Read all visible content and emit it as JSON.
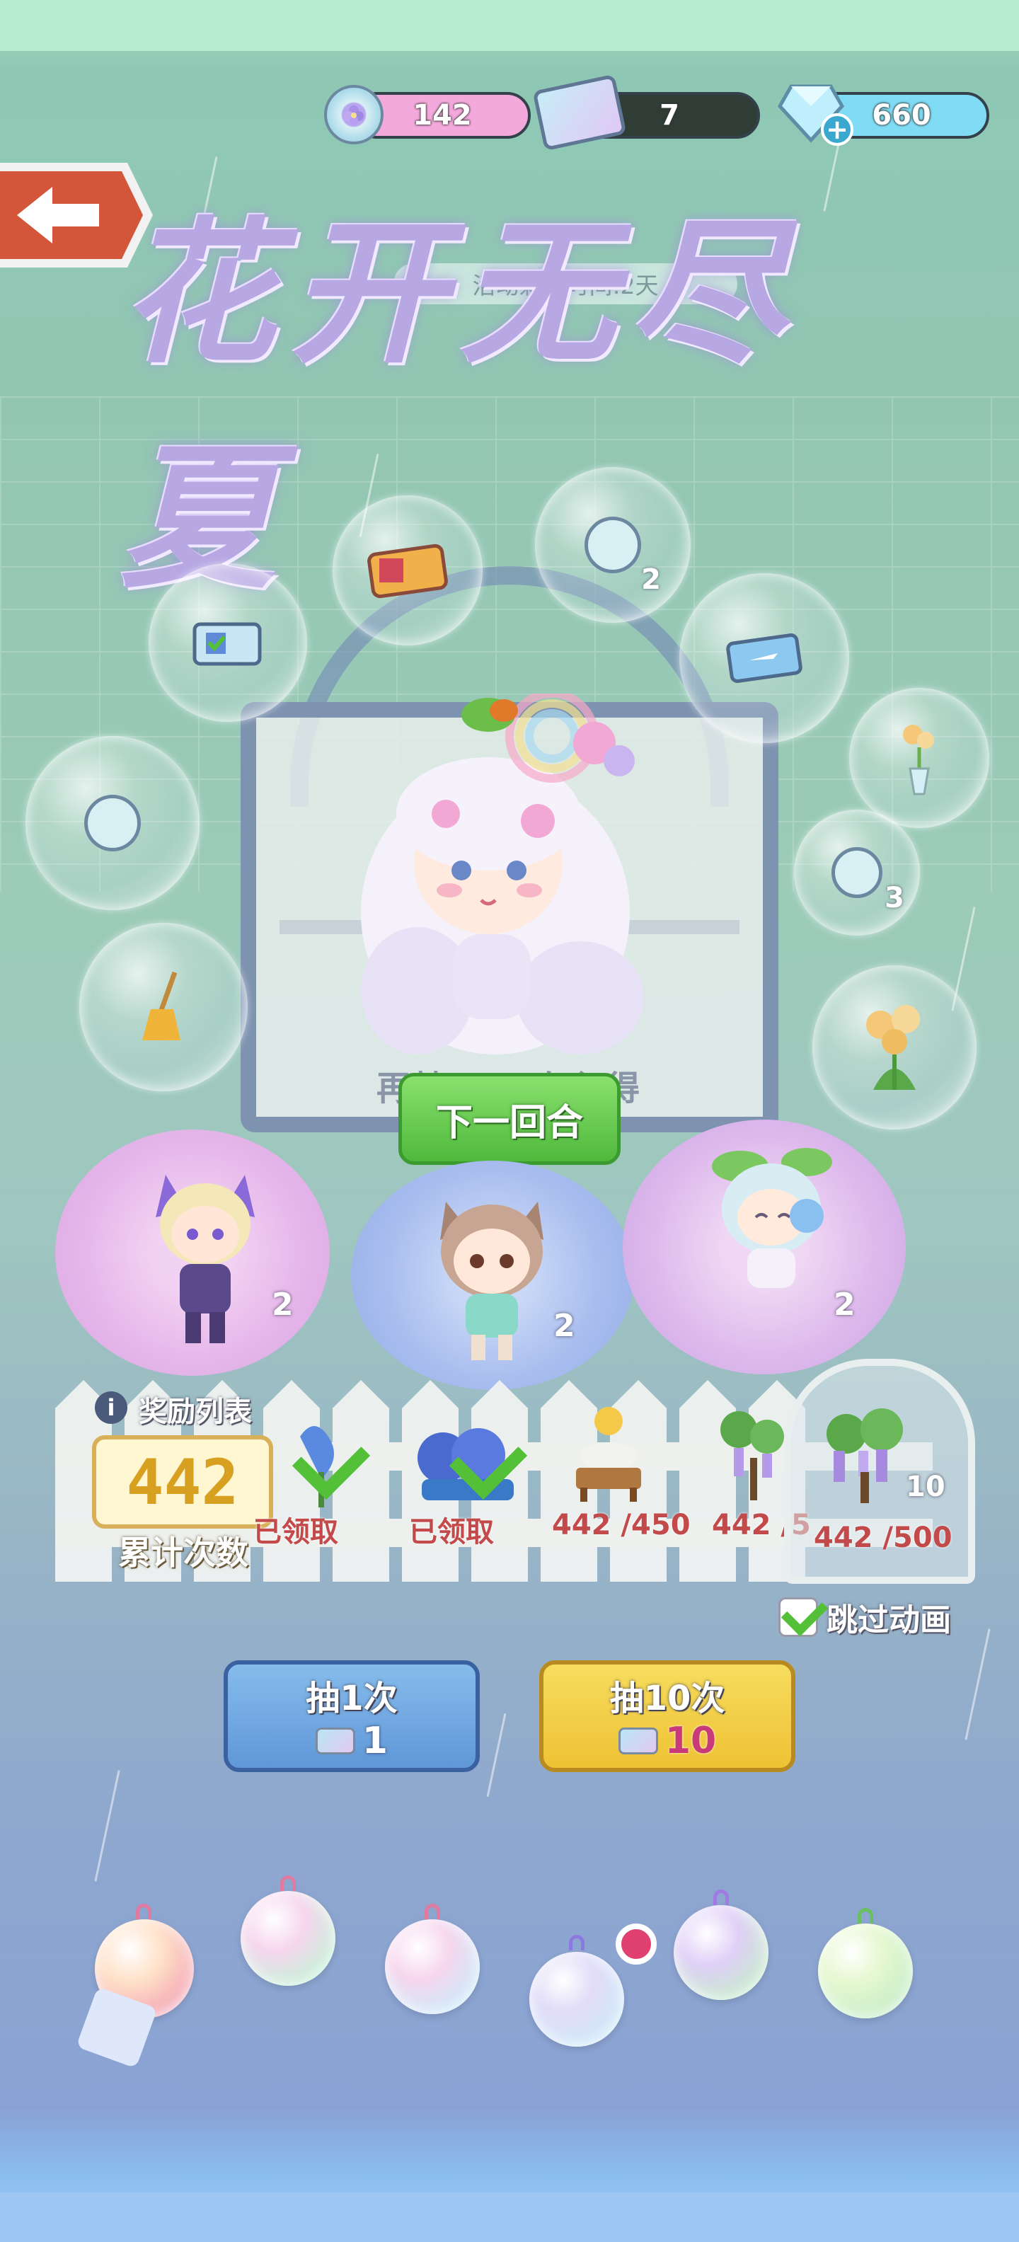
{
  "currency": {
    "flower_tokens": "142",
    "tickets": "7",
    "diamonds": "660"
  },
  "event": {
    "timer": "活动剩余时间:2天",
    "title": "花开无尽夏"
  },
  "pool_bubbles": [
    {
      "name": "ticket-stack-bubble",
      "count": ""
    },
    {
      "name": "flower-token-bubble",
      "count": "2"
    },
    {
      "name": "blue-ticket-bubble",
      "count": ""
    },
    {
      "name": "plane-ticket-bubble",
      "count": ""
    },
    {
      "name": "vase-bubble",
      "count": ""
    },
    {
      "name": "flower-token-bubble-2",
      "count": "3"
    },
    {
      "name": "flower-token-bubble-3",
      "count": ""
    },
    {
      "name": "broom-bubble",
      "count": ""
    },
    {
      "name": "flower-bush-bubble",
      "count": ""
    }
  ],
  "guarantee_text": "再抽 58 次必得",
  "next_round_button": "下一回合",
  "characters": [
    {
      "name": "fox-boy",
      "count": "2"
    },
    {
      "name": "cat-girl",
      "count": "2"
    },
    {
      "name": "fairy-girl",
      "count": "2"
    }
  ],
  "reward_list": {
    "label": "奖励列表",
    "counter_value": "442",
    "counter_label": "累计次数",
    "items": [
      {
        "status": "已领取"
      },
      {
        "status": "已领取"
      },
      {
        "status": "442 /450"
      },
      {
        "status": "442 /5"
      }
    ],
    "final_item": {
      "status": "442 /500",
      "count": "10"
    }
  },
  "skip_animation": "跳过动画",
  "draw_buttons": {
    "single": {
      "label": "抽1次",
      "cost": "1"
    },
    "ten": {
      "label": "抽10次",
      "cost": "10"
    }
  },
  "colors": {
    "next_green": "#54c038",
    "single_blue": "#6fa8df",
    "ten_yellow": "#f2cf3f",
    "token_pink": "#f2a8d8",
    "diamond_cyan": "#7fdcf4"
  }
}
